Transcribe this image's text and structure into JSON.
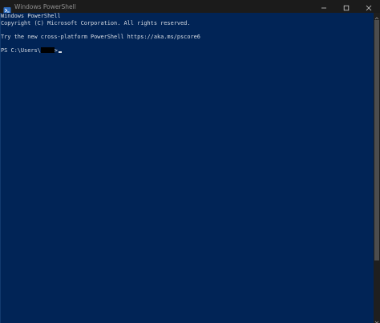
{
  "window": {
    "title": "Windows PowerShell",
    "icon": "powershell-icon",
    "controls": [
      "minimize-icon",
      "maximize-icon",
      "close-icon"
    ]
  },
  "console": {
    "lines": [
      "Windows PowerShell",
      "Copyright (C) Microsoft Corporation. All rights reserved.",
      "",
      "Try the new cross-platform PowerShell https://aka.ms/pscore6",
      ""
    ],
    "prompt_prefix": "PS C:\\Users\\",
    "prompt_suffix": ">"
  },
  "colors": {
    "console_background": "#012456",
    "console_text": "#d6dbe3",
    "titlebar": "#1b1b1b",
    "scrollbar": "#1f1f1f"
  }
}
